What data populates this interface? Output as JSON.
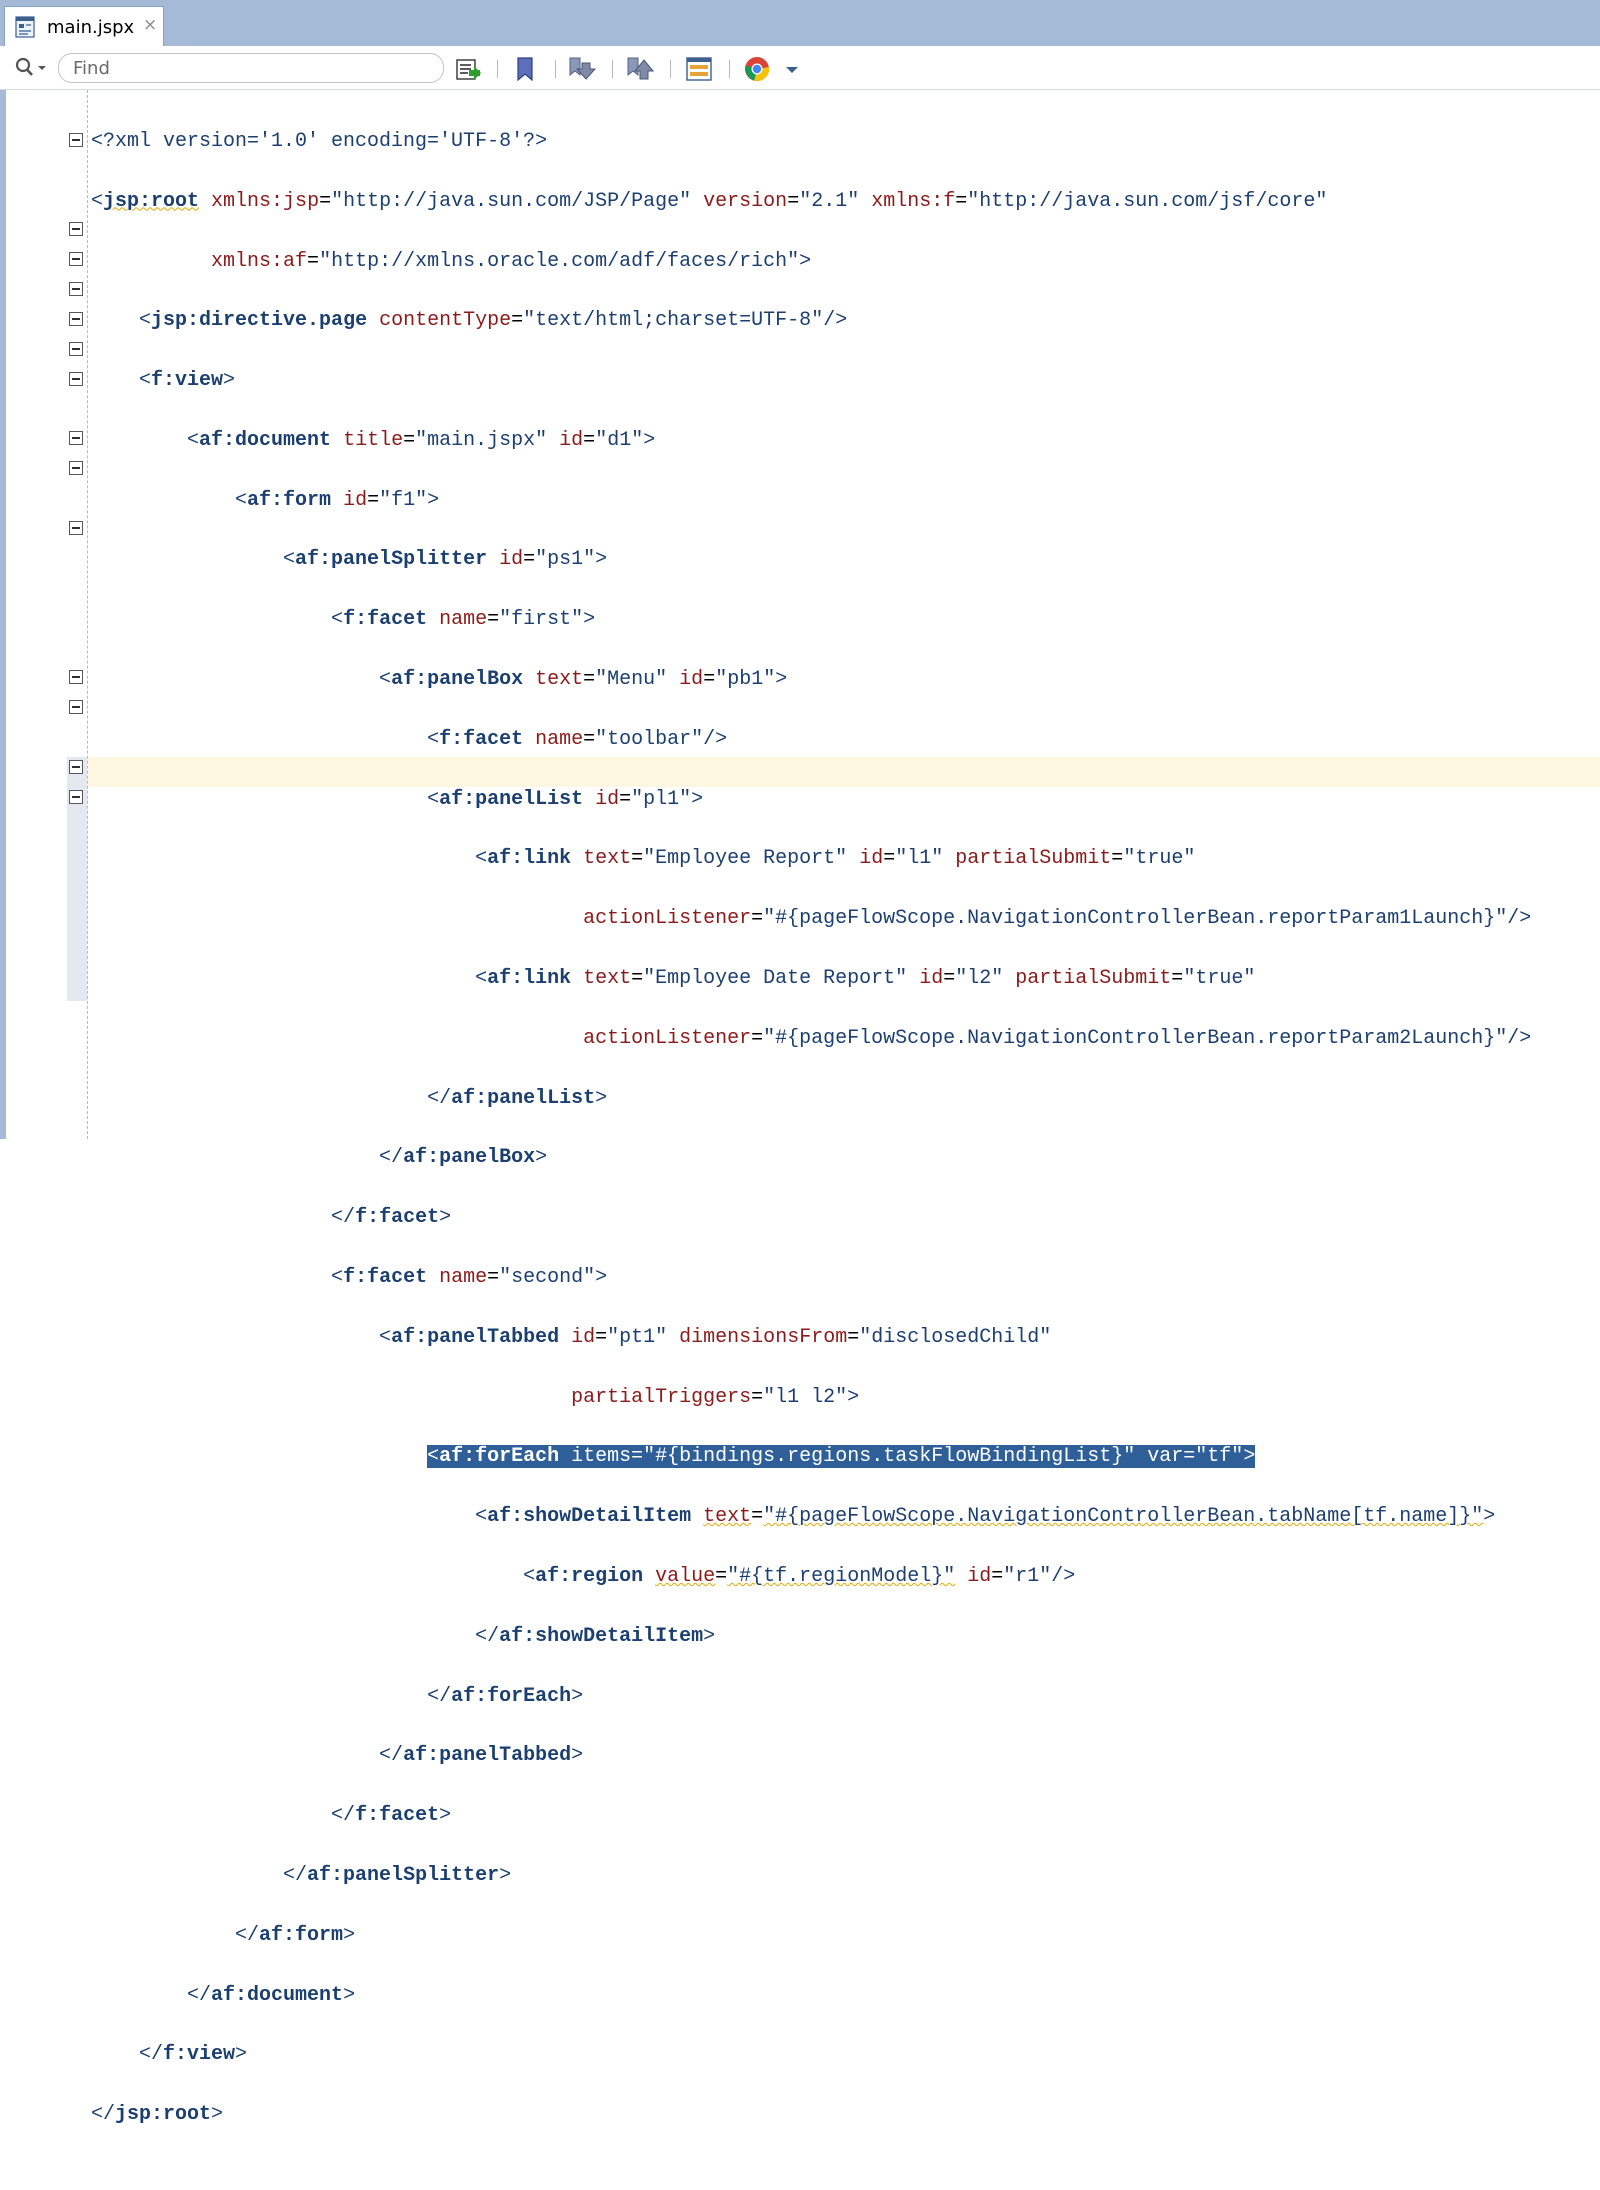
{
  "tab": {
    "label": "main.jspx",
    "close": "×"
  },
  "toolbar": {
    "find_placeholder": "Find"
  },
  "code": {
    "l1_prolog": "<?xml version='1.0' encoding='UTF-8'?>",
    "l2_open": "<",
    "l2_tag": "jsp:root",
    "l2_a1": "xmlns:jsp",
    "l2_v1": "\"http://java.sun.com/JSP/Page\"",
    "l2_a2": "version",
    "l2_v2": "\"2.1\"",
    "l2_a3": "xmlns:f",
    "l2_v3": "\"http://java.sun.com/jsf/core\"",
    "l3_a1": "xmlns:af",
    "l3_v1": "\"http://xmlns.oracle.com/adf/faces/rich\"",
    "l3_end": ">",
    "l4_tag": "jsp:directive.page",
    "l4_a1": "contentType",
    "l4_v1": "\"text/html;charset=UTF-8\"",
    "l4_end": "/>",
    "l5_tag": "f:view",
    "l6_tag": "af:document",
    "l6_a1": "title",
    "l6_v1": "\"main.jspx\"",
    "l6_a2": "id",
    "l6_v2": "\"d1\"",
    "l7_tag": "af:form",
    "l7_a1": "id",
    "l7_v1": "\"f1\"",
    "l8_tag": "af:panelSplitter",
    "l8_a1": "id",
    "l8_v1": "\"ps1\"",
    "l9_tag": "f:facet",
    "l9_a1": "name",
    "l9_v1": "\"first\"",
    "l10_tag": "af:panelBox",
    "l10_a1": "text",
    "l10_v1": "\"Menu\"",
    "l10_a2": "id",
    "l10_v2": "\"pb1\"",
    "l11_tag": "f:facet",
    "l11_a1": "name",
    "l11_v1": "\"toolbar\"",
    "l12_tag": "af:panelList",
    "l12_a1": "id",
    "l12_v1": "\"pl1\"",
    "l13_tag": "af:link",
    "l13_a1": "text",
    "l13_v1": "\"Employee Report\"",
    "l13_a2": "id",
    "l13_v2": "\"l1\"",
    "l13_a3": "partialSubmit",
    "l13_v3": "\"true\"",
    "l14_a1": "actionListener",
    "l14_v1": "\"#{pageFlowScope.NavigationControllerBean.reportParam1Launch}\"",
    "l15_tag": "af:link",
    "l15_a1": "text",
    "l15_v1": "\"Employee Date Report\"",
    "l15_a2": "id",
    "l15_v2": "\"l2\"",
    "l15_a3": "partialSubmit",
    "l15_v3": "\"true\"",
    "l16_a1": "actionListener",
    "l16_v1": "\"#{pageFlowScope.NavigationControllerBean.reportParam2Launch}\"",
    "l17_tag": "af:panelList",
    "l18_tag": "af:panelBox",
    "l19_tag": "f:facet",
    "l20_tag": "f:facet",
    "l20_a1": "name",
    "l20_v1": "\"second\"",
    "l21_tag": "af:panelTabbed",
    "l21_a1": "id",
    "l21_v1": "\"pt1\"",
    "l21_a2": "dimensionsFrom",
    "l21_v2": "\"disclosedChild\"",
    "l22_a1": "partialTriggers",
    "l22_v1": "\"l1 l2\"",
    "l23_tag": "af:forEach",
    "l23_a1": "items",
    "l23_v1": "\"#{bindings.regions.taskFlowBindingList}\"",
    "l23_a2": "var",
    "l23_v2": "\"tf\"",
    "l24_tag": "af:showDetailItem",
    "l24_a1": "text",
    "l24_v1": "\"#{pageFlowScope.NavigationControllerBean.tabName[tf.name]}\"",
    "l25_tag": "af:region",
    "l25_a1": "value",
    "l25_v1": "\"#{tf.regionModel}\"",
    "l25_a2": "id",
    "l25_v2": "\"r1\"",
    "l26_tag": "af:showDetailItem",
    "l27_tag": "af:forEach",
    "l28_tag": "af:panelTabbed",
    "l29_tag": "f:facet",
    "l30_tag": "af:panelSplitter",
    "l31_tag": "af:form",
    "l32_tag": "af:document",
    "l33_tag": "f:view",
    "l34_tag": "jsp:root"
  }
}
